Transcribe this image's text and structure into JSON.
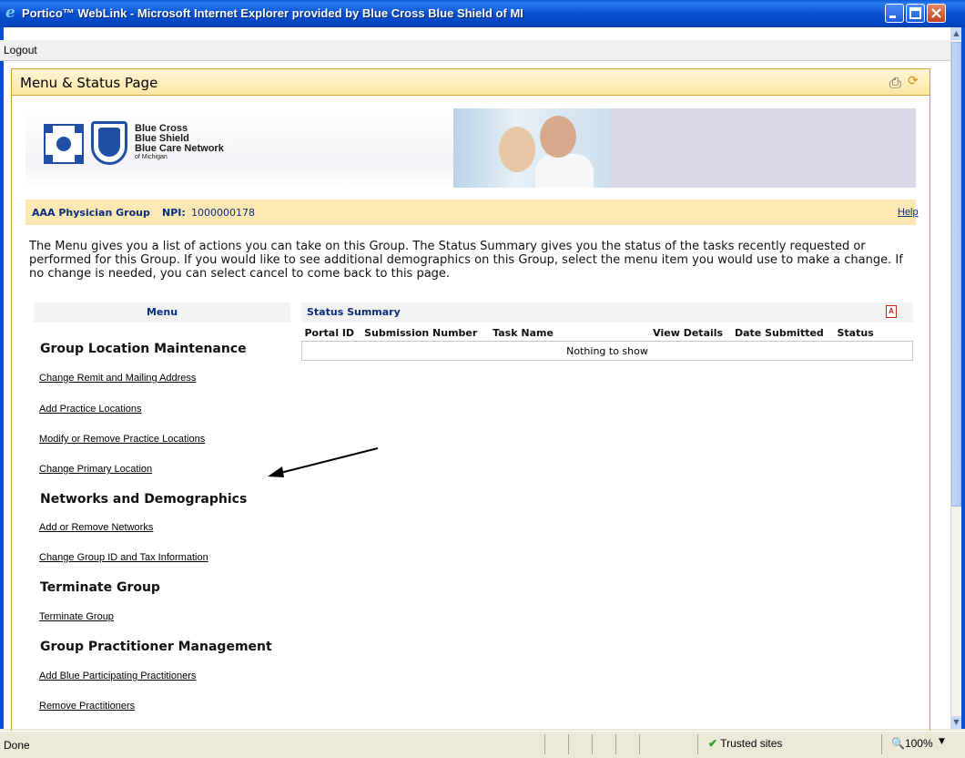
{
  "window": {
    "title": "Portico™ WebLink - Microsoft Internet Explorer provided by Blue Cross Blue Shield of MI"
  },
  "menubar": {
    "logout": "Logout"
  },
  "page": {
    "title": "Menu & Status Page"
  },
  "banner": {
    "line1": "Blue Cross",
    "line2": "Blue Shield",
    "line3": "Blue Care Network",
    "line4": "of Michigan"
  },
  "group": {
    "name": "AAA Physician Group",
    "npi_label": "NPI:",
    "npi_value": "1000000178",
    "help": "Help"
  },
  "intro": "The Menu gives you a list of actions you can take on this Group. The Status Summary gives you the status of the tasks recently requested or performed for this Group. If you would like to see additional demographics on this Group, select the menu item you would use to make a change. If no change is needed, you can select cancel to come back to this page.",
  "menu": {
    "title": "Menu",
    "sections": [
      {
        "title": "Group Location Maintenance",
        "links": [
          "Change Remit and Mailing Address",
          "Add Practice Locations",
          "Modify or Remove Practice Locations",
          "Change Primary Location"
        ]
      },
      {
        "title": "Networks and Demographics",
        "links": [
          "Add or Remove Networks",
          "Change Group ID and Tax Information"
        ]
      },
      {
        "title": "Terminate Group",
        "links": [
          "Terminate Group"
        ]
      },
      {
        "title": "Group Practitioner Management",
        "links": [
          "Add Blue Participating Practitioners",
          "Remove Practitioners"
        ]
      }
    ]
  },
  "status": {
    "title": "Status Summary",
    "columns": [
      "Portal ID",
      "Submission Number",
      "Task Name",
      "View Details",
      "Date Submitted",
      "Status"
    ],
    "empty": "Nothing to show"
  },
  "statusbar": {
    "left": "Done",
    "zone": "Trusted sites",
    "zoom": "100%"
  },
  "colors": {
    "title_bar": "#0751D0",
    "header_bg": "#FCE6A4",
    "link_text": "#0A2D7A"
  }
}
